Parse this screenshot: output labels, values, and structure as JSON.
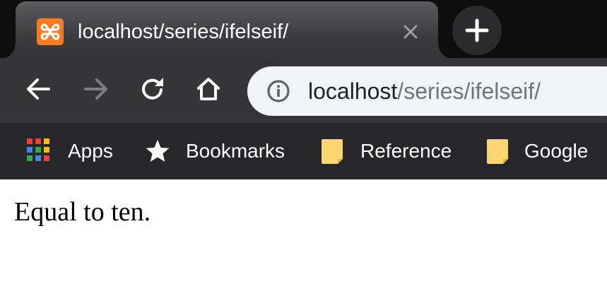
{
  "tab": {
    "title": "localhost/series/ifelseif/",
    "favicon": "xampp-icon",
    "close_icon": "close-icon"
  },
  "new_tab": {
    "icon": "plus-icon"
  },
  "toolbar": {
    "back_icon": "arrow-left-icon",
    "forward_icon": "arrow-right-icon",
    "reload_icon": "reload-icon",
    "home_icon": "home-icon"
  },
  "address_bar": {
    "host": "localhost",
    "path": "/series/ifelseif/",
    "info_icon": "info-icon"
  },
  "bookmarks": {
    "items": [
      {
        "label": "Apps",
        "icon": "apps-grid-icon"
      },
      {
        "label": "Bookmarks",
        "icon": "star-icon"
      },
      {
        "label": "Reference",
        "icon": "folder-icon"
      },
      {
        "label": "Google",
        "icon": "folder-icon"
      }
    ]
  },
  "page": {
    "body_text": "Equal to ten."
  },
  "colors": {
    "tab_strip": "#0e0e0f",
    "active_tab": "#3c3c3e",
    "toolbar": "#353537",
    "bookmarks_bar": "#27272a",
    "omnibox": "#f1f3f4",
    "favicon": "#fb7a24",
    "folder": "#fcd670",
    "url_host": "#202124",
    "url_path": "#70757a"
  }
}
